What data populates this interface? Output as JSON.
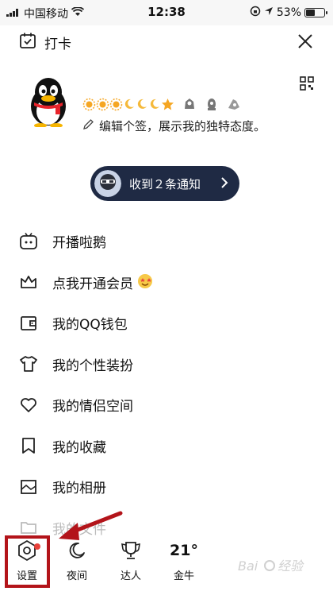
{
  "status_bar": {
    "carrier": "中国移动",
    "time": "12:38",
    "battery": "53%",
    "battery_level": 0.53
  },
  "header": {
    "checkin_label": "打卡"
  },
  "profile": {
    "level_icons": [
      "sun",
      "sun",
      "sun",
      "moon",
      "moon",
      "moon",
      "star"
    ],
    "signature": "编辑个签，展示我的独特态度。"
  },
  "notification": {
    "text": "收到２条通知"
  },
  "menu": {
    "items": [
      {
        "label": "开播啦鹅",
        "icon": "tv-icon"
      },
      {
        "label": "点我开通会员",
        "icon": "crown-icon"
      },
      {
        "label": "我的QQ钱包",
        "icon": "wallet-icon"
      },
      {
        "label": "我的个性装扮",
        "icon": "shirt-icon"
      },
      {
        "label": "我的情侣空间",
        "icon": "heart-icon"
      },
      {
        "label": "我的收藏",
        "icon": "bookmark-icon"
      },
      {
        "label": "我的相册",
        "icon": "photo-icon"
      },
      {
        "label": "我的文件",
        "icon": "folder-icon"
      }
    ]
  },
  "bottom": {
    "settings_label": "设置",
    "night_label": "夜间",
    "expert_label": "达人",
    "weather_temp": "21°",
    "weather_place": "金牛"
  },
  "colors": {
    "notify_bg": "#1f2a44",
    "highlight": "#b3141a",
    "badge": "#e8413a"
  }
}
